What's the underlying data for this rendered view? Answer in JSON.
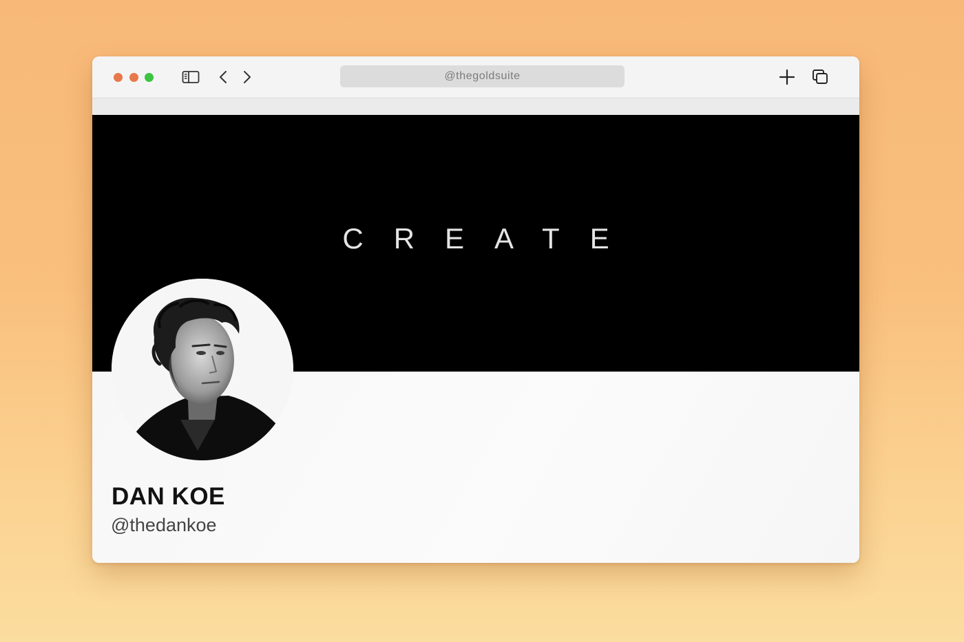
{
  "browser": {
    "address": "@thegoldsuite",
    "icons": {
      "close": "close-dot",
      "minimize": "minimize-dot",
      "maximize": "maximize-dot",
      "sidebar": "sidebar-icon",
      "back": "chevron-left-icon",
      "forward": "chevron-right-icon",
      "new_tab": "plus-icon",
      "tab_overview": "tabs-overview-icon"
    },
    "colors": {
      "close": "#e8774a",
      "minimize": "#e8774a",
      "maximize": "#3cc341"
    }
  },
  "banner": {
    "word": "CREATE",
    "background": "#000000"
  },
  "profile": {
    "name": "DAN KOE",
    "handle": "@thedankoe",
    "avatar": "profile-photo"
  }
}
